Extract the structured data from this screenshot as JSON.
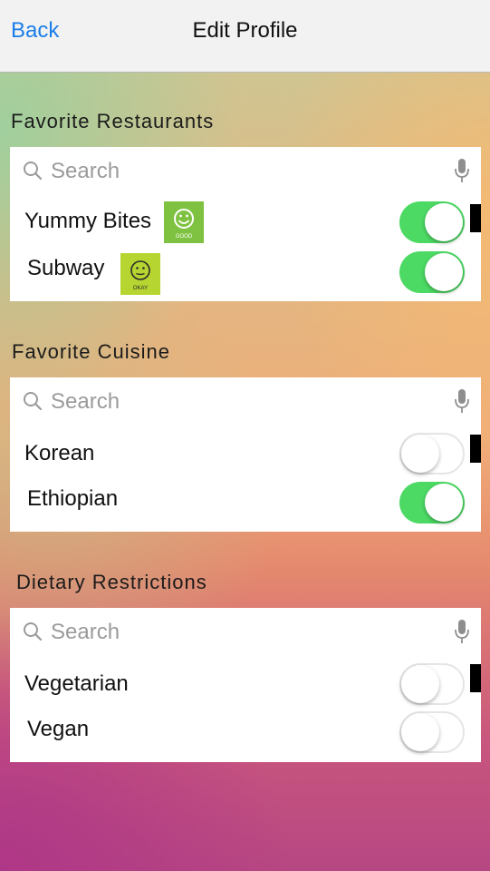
{
  "navbar": {
    "back_label": "Back",
    "title": "Edit Profile"
  },
  "sections": [
    {
      "header": "Favorite Restaurants",
      "search_placeholder": "Search",
      "items": [
        {
          "label": "Yummy Bites",
          "on": true,
          "badge_text": "GOOD",
          "badge_color": "#7fc241"
        },
        {
          "label": "Subway",
          "on": true,
          "badge_text": "OKAY",
          "badge_color": "#b7d531"
        }
      ]
    },
    {
      "header": "Favorite Cuisine",
      "search_placeholder": "Search",
      "items": [
        {
          "label": "Korean",
          "on": false
        },
        {
          "label": "Ethiopian",
          "on": true
        }
      ]
    },
    {
      "header": "Dietary Restrictions",
      "search_placeholder": "Search",
      "items": [
        {
          "label": "Vegetarian",
          "on": false
        },
        {
          "label": "Vegan",
          "on": false
        }
      ]
    }
  ],
  "colors": {
    "accent": "#1a7ee8",
    "toggle_on": "#4cd964"
  }
}
